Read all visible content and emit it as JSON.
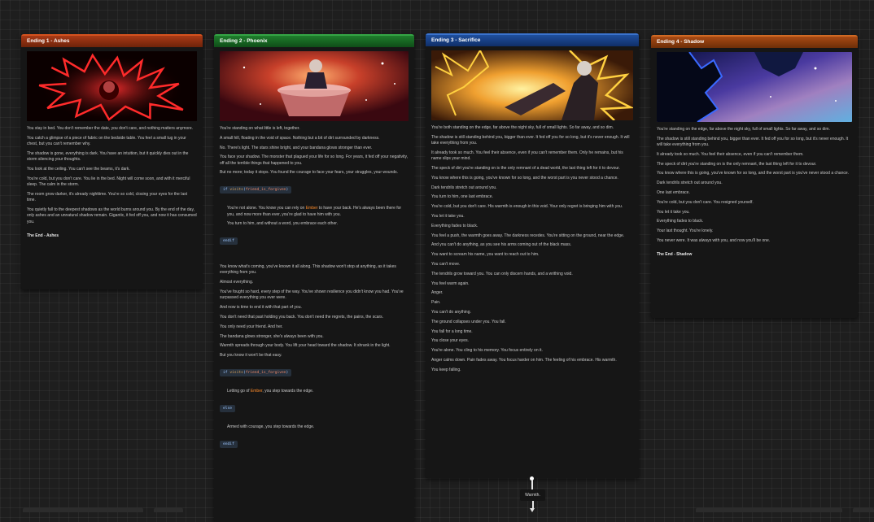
{
  "nodes": {
    "ashes": {
      "title": "Ending 1 - Ashes",
      "paragraphs": [
        "You stay in bed. You don't remember the date, you don't care, and nothing matters anymore.",
        "You catch a glimpse of a piece of fabric on the bedside table. You feel a small tug in your chest, but you can't remember why.",
        "The shadow is gone, everything is dark. You have an intuition, but it quickly dies out in the storm silencing your thoughts.",
        "You look at the ceiling. You can't see the beams, it's dark.",
        "You're cold, but you don't care. You lie in the bed. Night will come soon, and with it merciful sleep. The calm in the storm.",
        "The room grow darker, it's already nighttime. You're so cold, closing your eyes for the last time.",
        "You quietly fall to the deepest shadows as the world burns around you. By the end of the day, only ashes and an unnatural shadow remain. Gigantic, it fed off you, and now it has consumed you."
      ],
      "ending": "The End - Ashes"
    },
    "phoenix": {
      "title": "Ending 2 - Phoenix",
      "intro": [
        "You're standing on what little is left, together.",
        "A small hill, floating in the void of space. Nothing but a bit of dirt surrounded by darkness.",
        "No. There's light. The stars shine bright, and your bandana glows stronger than ever.",
        "You face your shadow. The monster that plagued your life for so long. For years, it fed off your negativity, off all the terrible things that happened to you.",
        "But no more; today it stops. You found the courage to face your fears, your struggles, your wounds."
      ],
      "cond1": {
        "kw": "if",
        "fn": "visits",
        "arg": "friend_is_forgiven"
      },
      "branch1_pre": "You're not alone. You know you can rely on ",
      "branch1_name": "Ember",
      "branch1_post": " to have your back. He's always been there for you, and now more than ever, you're glad to have him with you.",
      "branch1_b": "You turn to him, and without a word, you embrace each other.",
      "endif": "endif",
      "outro": [
        "You know what's coming, you've known it all along. This shadow won't stop at anything, as it takes everything from you.",
        "Almost everything.",
        "You've fought so hard, every step of the way. You've shown resilience you didn't know you had. You've surpassed everything you ever were.",
        "And now is time to end it with that part of you.",
        "You don't need that past holding you back. You don't need the regrets, the pains, the scars.",
        "You only need your friend. And her.",
        "The bandana glows stronger, she's always been with you.",
        "Warmth spreads through your body. You lift your head toward the shadow. It shrank in the light.",
        "But you know it won't be that easy."
      ],
      "cond2": {
        "kw": "if",
        "fn": "visits",
        "arg": "friend_is_forgiven"
      },
      "branch2_pre": "Letting go of ",
      "branch2_name": "Ember",
      "branch2_post": ", you step towards the edge.",
      "else": "else",
      "branch3": "Armed with courage, you step towards the edge.",
      "endif2": "endif"
    },
    "sacrifice": {
      "title": "Ending 3 - Sacrifice",
      "paragraphs": [
        "You're both standing on the edge, far above the night sky, full of small lights. So far away, and so dim.",
        "The shadow is still standing behind you, bigger than ever. It fed off you for so long, but it's never enough. It will take everything from you.",
        "It already took so much. You feel their absence, even if you can't remember them. Only he remains, but his name slips your mind.",
        "The speck of dirt you're standing on is the only remnant of a dead world, the last thing left for it to devour.",
        "You know where this is going, you've known for so long, and the worst part is you never stood a chance.",
        "Dark tendrils stretch out around you.",
        "You turn to him, one last embrace.",
        "You're cold, but you don't care. His warmth is enough in this void. Your only regret is bringing him with you.",
        "You let it take you.",
        "Everything fades to black.",
        "You feel a push, the warmth goes away. The darkness recedes. You're sitting on the ground, near the edge.",
        "And you can't do anything, as you see his arms coming out of the black mass.",
        "You want to scream his name, you want to reach out to him.",
        "You can't move.",
        "The tendrils grow toward you. You can only discern hands, and a writhing void.",
        "You feel warm again.",
        "Anger.",
        "Pain.",
        "You can't do anything.",
        "The ground collapses under you. You fall.",
        "You fall for a long time.",
        "You close your eyes.",
        "You're alone. You cling to his memory. You focus entirely on it.",
        "Anger calms down. Pain fades away. You focus harder on him. The feeling of his embrace. His warmth.",
        "You keep falling."
      ]
    },
    "shadow": {
      "title": "Ending 4 - Shadow",
      "paragraphs": [
        "You're standing on the edge, far above the night sky, full of small lights. So far away, and so dim.",
        "The shadow is still standing behind you, bigger than ever. It fed off you for so long, but it's never enough. It will take everything from you.",
        "It already took so much. You feel their absence, even if you can't remember them.",
        "The speck of dirt you're standing on is the only remnant, the last thing left for it to devour.",
        "You know where this is going, you've known for so long, and the worst part is you've never stood a chance.",
        "Dark tendrils stretch out around you.",
        "One last embrace.",
        "You're cold, but you don't care. You resigned yourself.",
        "You let it take you.",
        "Everything fades to black.",
        "Your last thought. You're lonely.",
        "You never were. It was always with you, and now you'll be one."
      ],
      "ending": "The End - Shadow"
    }
  },
  "choice": {
    "label": "Warmth."
  },
  "colors": {
    "ashes": "#d4521e",
    "phoenix": "#35a445",
    "sacrifice": "#3a72cc",
    "shadow": "#d06a24",
    "highlight": "#ff8c2a"
  }
}
